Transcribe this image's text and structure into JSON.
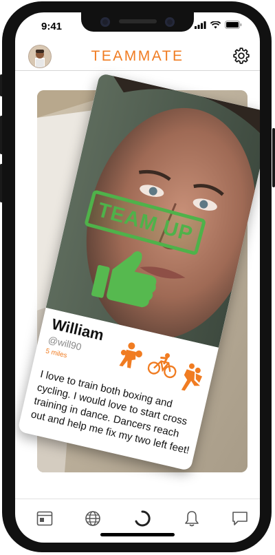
{
  "status": {
    "time": "9:41"
  },
  "header": {
    "title": "TEAMMATE"
  },
  "card": {
    "name": "William",
    "handle": "@will90",
    "distance": "5 miles",
    "stamp": "TEAM UP",
    "bio": "I love to train both boxing and cycling. I would love to start cross training in dance. Dancers reach out and help me fix my two left feet!",
    "sports": [
      "boxing-icon",
      "cycling-icon",
      "dance-icon"
    ]
  },
  "colors": {
    "accent": "#f07c22",
    "match": "#4fb24a"
  },
  "tabs": [
    "card-icon",
    "globe-icon",
    "loading-icon",
    "bell-icon",
    "chat-icon"
  ]
}
